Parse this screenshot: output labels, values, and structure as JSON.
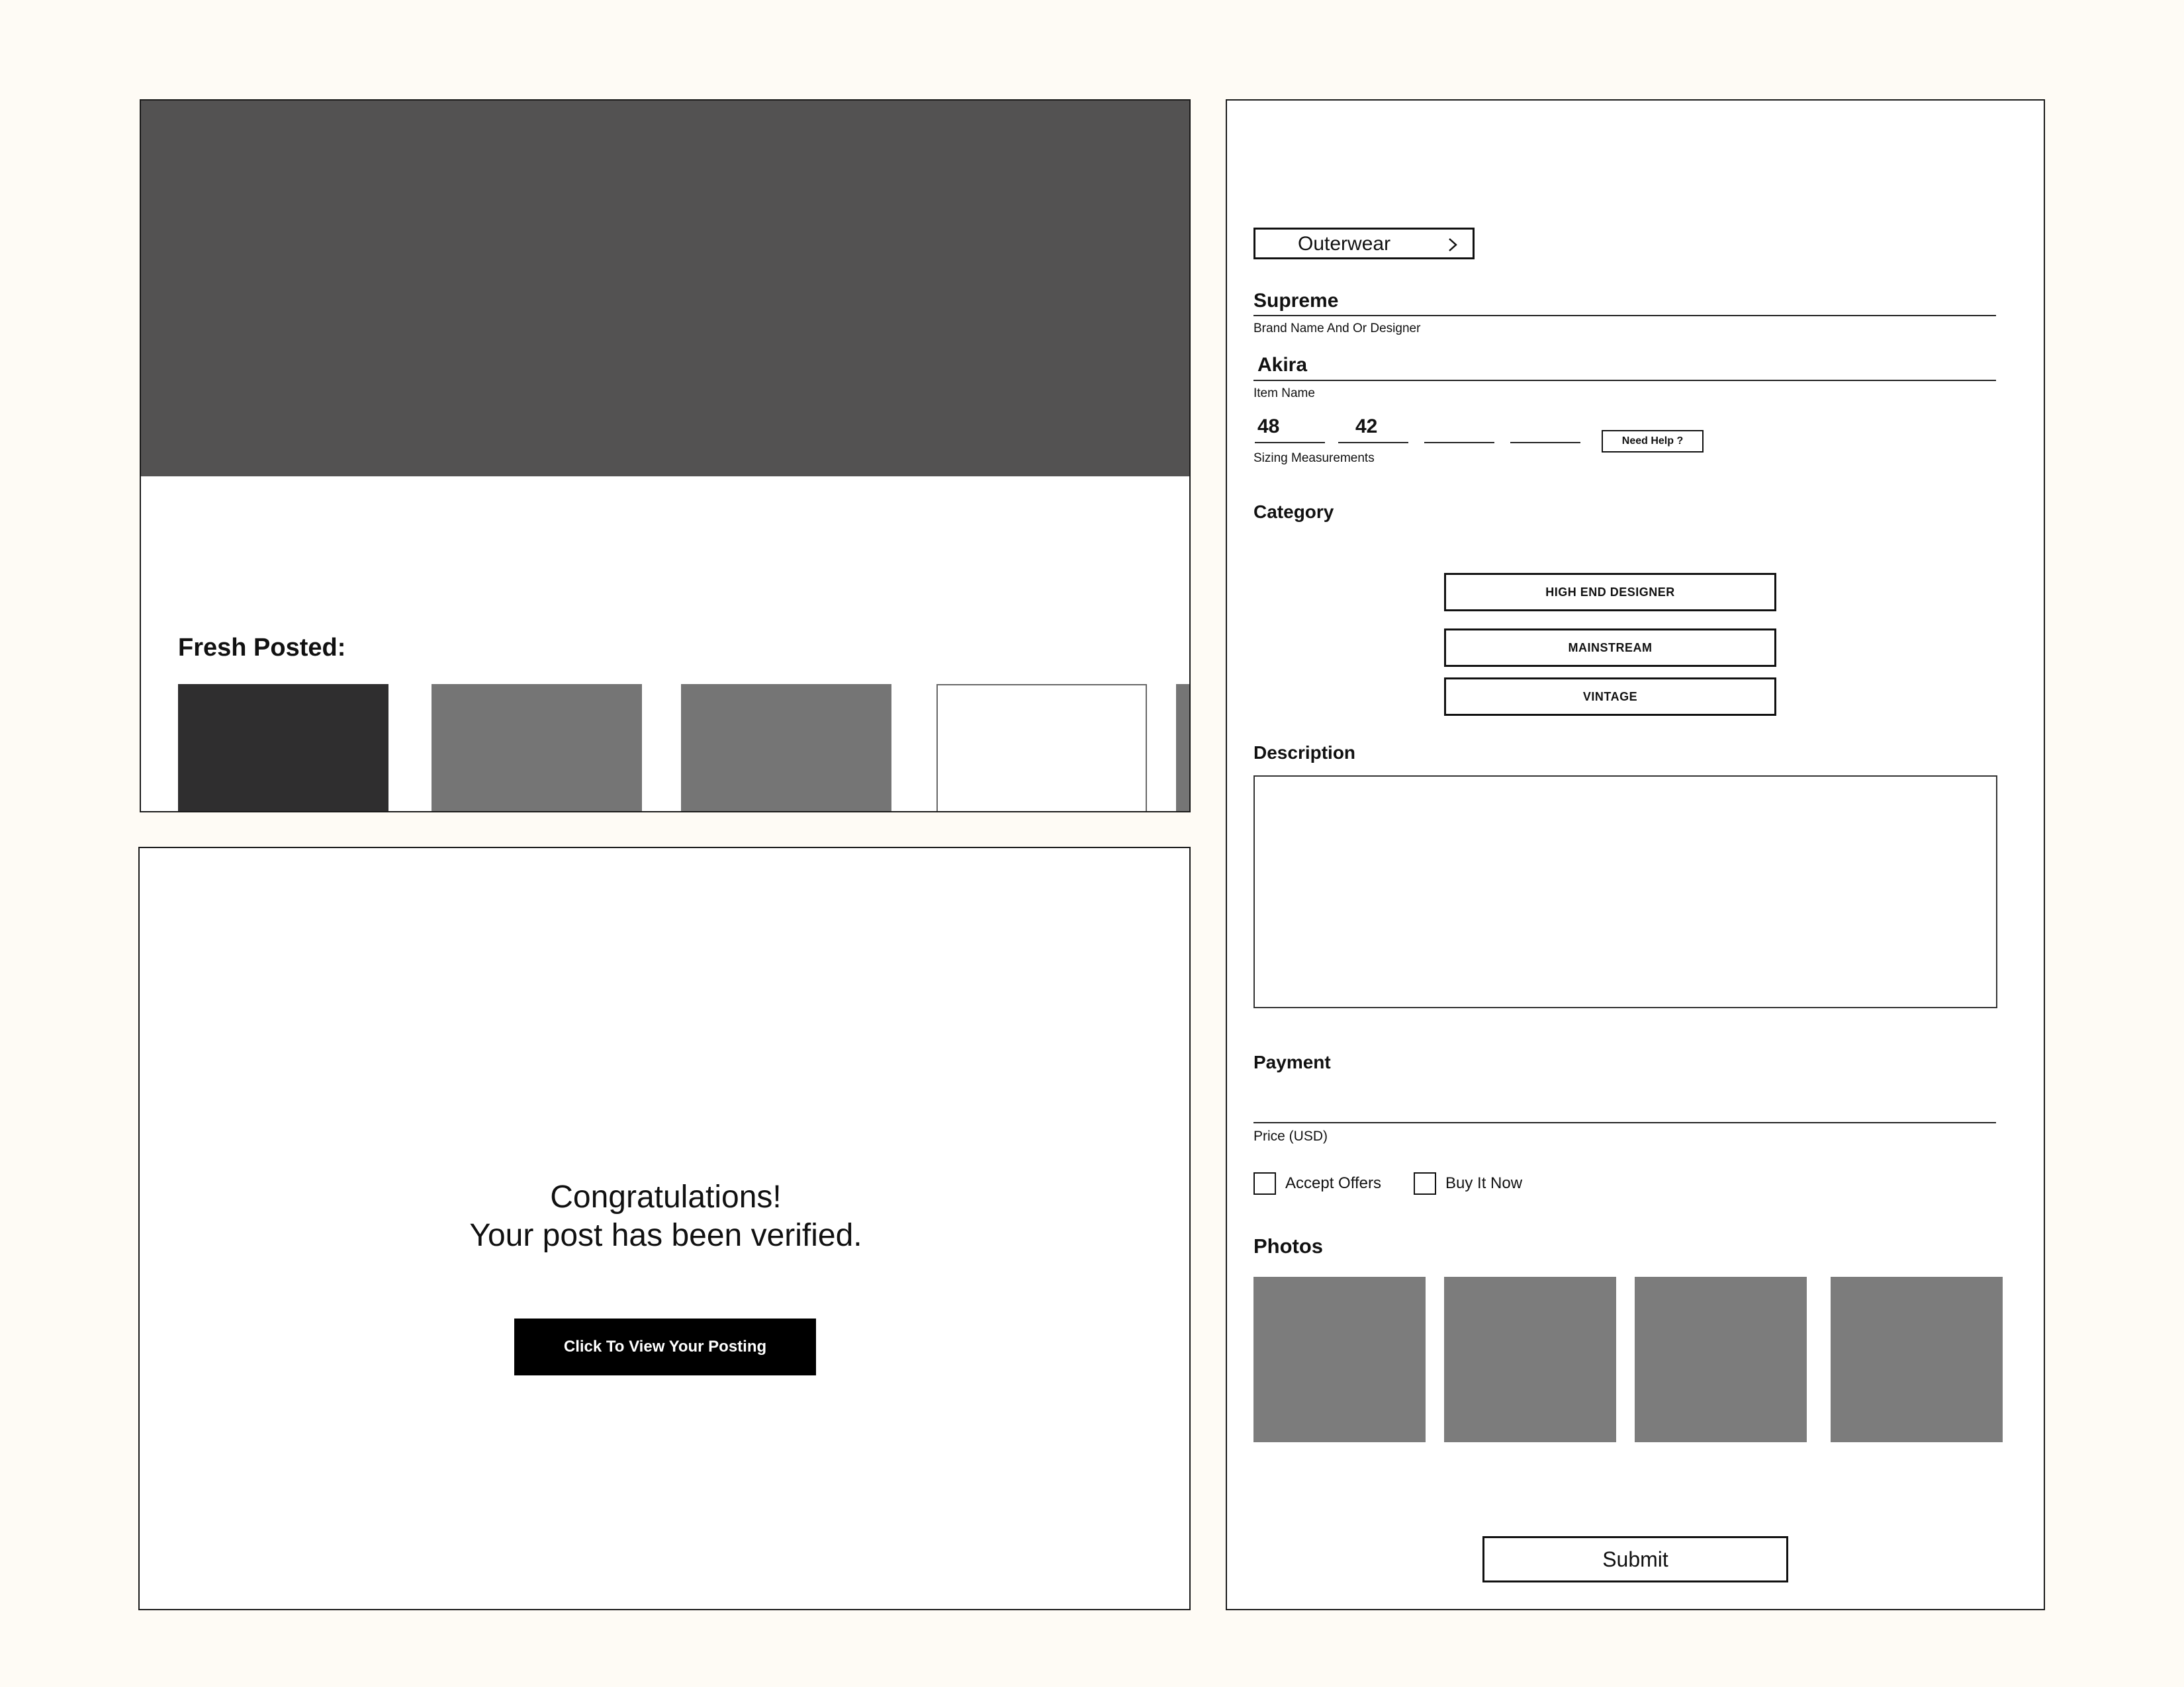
{
  "home": {
    "carousel_dots": [
      {
        "name": "carousel-dot-1",
        "active": true
      },
      {
        "name": "carousel-dot-2",
        "active": false
      },
      {
        "name": "carousel-dot-3",
        "active": false
      },
      {
        "name": "carousel-dot-4",
        "active": false
      }
    ],
    "fresh_title": "Fresh Posted:",
    "thumbnail_colors": [
      "#2f2e2f",
      "#757575",
      "#757575",
      "#ffffff",
      "#757575"
    ]
  },
  "success": {
    "line1": "Congratulations!",
    "line2": "Your post has been verified.",
    "button_label": "Click To View Your Posting"
  },
  "form": {
    "category_button": {
      "label": "Outerwear",
      "icon": "chevron-right-icon"
    },
    "brand": {
      "value": "Supreme",
      "label": "Brand Name And Or Designer"
    },
    "item": {
      "value": "Akira",
      "label": "Item Name"
    },
    "sizing": {
      "values": [
        "48",
        "42",
        "",
        ""
      ],
      "label": "Sizing Measurements",
      "help_button": "Need Help ?"
    },
    "category": {
      "title": "Category",
      "options": [
        "HIGH END DESIGNER",
        "MAINSTREAM",
        "VINTAGE"
      ]
    },
    "description": {
      "title": "Description",
      "value": ""
    },
    "payment": {
      "title": "Payment",
      "price_value": "",
      "price_label": "Price (USD)"
    },
    "checkboxes": [
      {
        "label": "Accept Offers",
        "checked": false
      },
      {
        "label": "Buy It Now",
        "checked": false
      }
    ],
    "photos": {
      "title": "Photos",
      "count": 4,
      "color": "#7c7c7c"
    },
    "submit_label": "Submit"
  }
}
